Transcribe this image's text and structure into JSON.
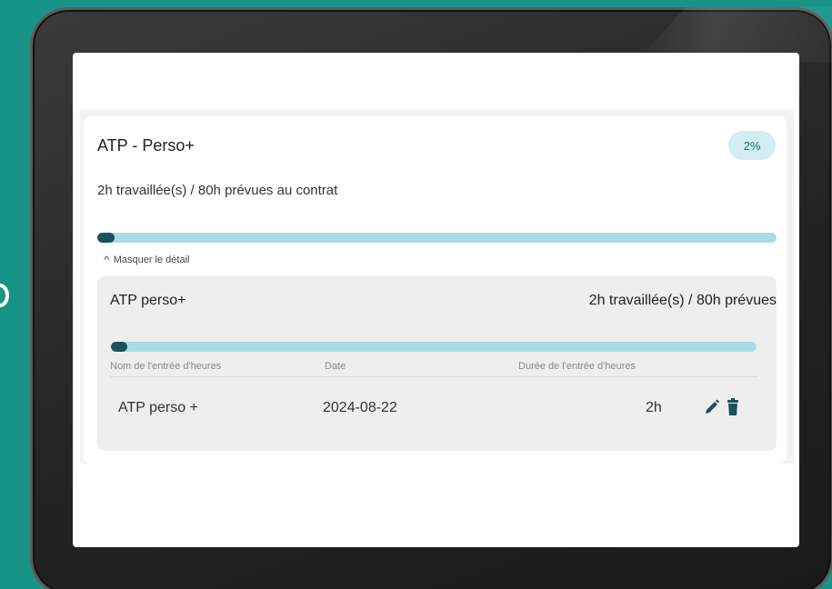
{
  "card": {
    "title": "ATP - Perso+",
    "badge": "2%",
    "summary": "2h travaillée(s) / 80h prévues au contrat",
    "progress": 0.025,
    "toggle_label": "Masquer le détail"
  },
  "detail": {
    "title": "ATP perso+",
    "summary": "2h travaillée(s) / 80h prévues",
    "progress": 0.025,
    "columns": [
      "Nom de l'entrée d'heures",
      "Date",
      "Durée de l'entrée d'heures"
    ],
    "rows": [
      {
        "name": "ATP perso +",
        "date": "2024-08-22",
        "duration": "2h"
      }
    ]
  },
  "colors": {
    "background": "#189487",
    "progress_track": "#a9dde3",
    "progress_fill": "#1e4f5c",
    "badge_bg": "#d2eef2"
  },
  "icons": [
    "chevron-up-icon",
    "pencil-icon",
    "trash-icon"
  ]
}
